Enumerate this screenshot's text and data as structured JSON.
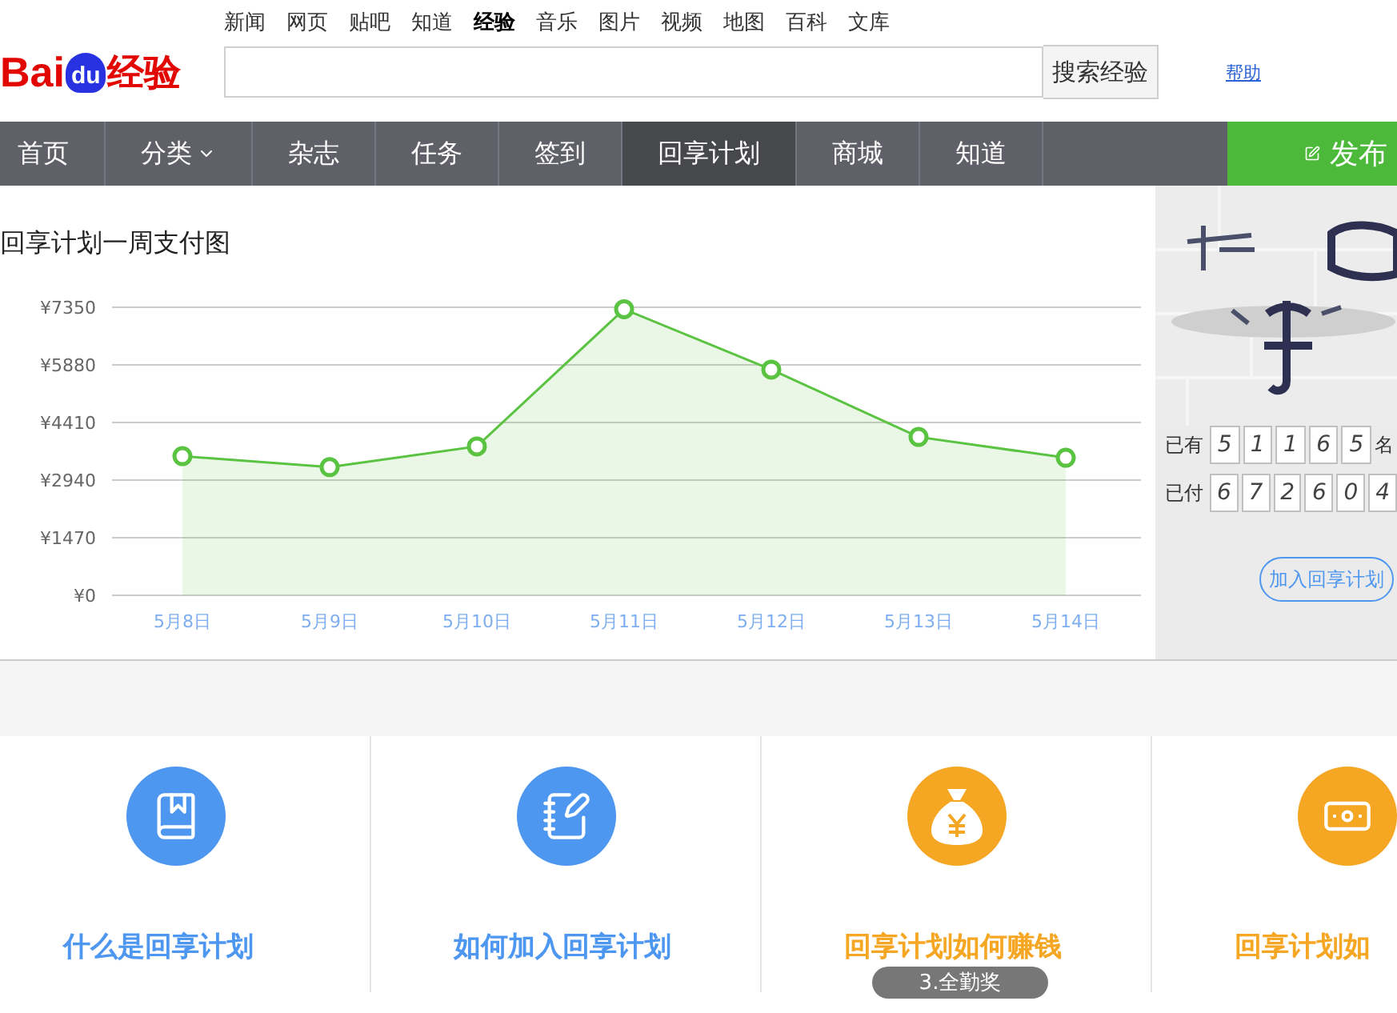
{
  "logo": {
    "brand": "Bai",
    "paw": "du",
    "product": "经验"
  },
  "top_links": [
    {
      "label": "新闻",
      "selected": false
    },
    {
      "label": "网页",
      "selected": false
    },
    {
      "label": "贴吧",
      "selected": false
    },
    {
      "label": "知道",
      "selected": false
    },
    {
      "label": "经验",
      "selected": true
    },
    {
      "label": "音乐",
      "selected": false
    },
    {
      "label": "图片",
      "selected": false
    },
    {
      "label": "视频",
      "selected": false
    },
    {
      "label": "地图",
      "selected": false
    },
    {
      "label": "百科",
      "selected": false
    },
    {
      "label": "文库",
      "selected": false
    }
  ],
  "search": {
    "button": "搜索经验",
    "help": "帮助"
  },
  "nav": [
    {
      "label": "首页",
      "selected": false,
      "has_menu": false
    },
    {
      "label": "分类",
      "selected": false,
      "has_menu": true
    },
    {
      "label": "杂志",
      "selected": false,
      "has_menu": false
    },
    {
      "label": "任务",
      "selected": false,
      "has_menu": false
    },
    {
      "label": "签到",
      "selected": false,
      "has_menu": false
    },
    {
      "label": "回享计划",
      "selected": true,
      "has_menu": false
    },
    {
      "label": "商城",
      "selected": false,
      "has_menu": false
    },
    {
      "label": "知道",
      "selected": false,
      "has_menu": false
    }
  ],
  "publish_button": "发布",
  "chart": {
    "title": "回享计划一周支付图",
    "chart_data": {
      "type": "area",
      "categories": [
        "5月8日",
        "5月9日",
        "5月10日",
        "5月11日",
        "5月12日",
        "5月13日",
        "5月14日"
      ],
      "grid": true,
      "series": [
        {
          "color": "#5ac341",
          "values": [
            3550,
            3270,
            3800,
            7300,
            5760,
            4040,
            3510
          ]
        }
      ],
      "ylim": [
        0,
        7350
      ],
      "yticks": [
        {
          "value": 0,
          "label": "¥0"
        },
        {
          "value": 1470,
          "label": "¥1470"
        },
        {
          "value": 2940,
          "label": "¥2940"
        },
        {
          "value": 4410,
          "label": "¥4410"
        },
        {
          "value": 5880,
          "label": "¥5880"
        },
        {
          "value": 7350,
          "label": "¥7350"
        }
      ]
    }
  },
  "stats": {
    "kind": "picture",
    "rows": [
      {
        "label": "已有",
        "digits": [
          "5",
          "1",
          "1",
          "6",
          "5"
        ],
        "unit": "名"
      },
      {
        "label": "已付",
        "digits": [
          "6",
          "7",
          "2",
          "6",
          "0",
          "4"
        ]
      }
    ],
    "join_button": "加入回享计划"
  },
  "cards": [
    {
      "title": "什么是回享计划",
      "color": "#4e97f0"
    },
    {
      "title": "如何加入回享计划",
      "color": "#4e97f0"
    },
    {
      "title": "回享计划如何赚钱",
      "color": "#f5a623"
    },
    {
      "title": "回享计划如",
      "color": "#f5a623"
    }
  ],
  "step_badge": "3.全勤奖"
}
